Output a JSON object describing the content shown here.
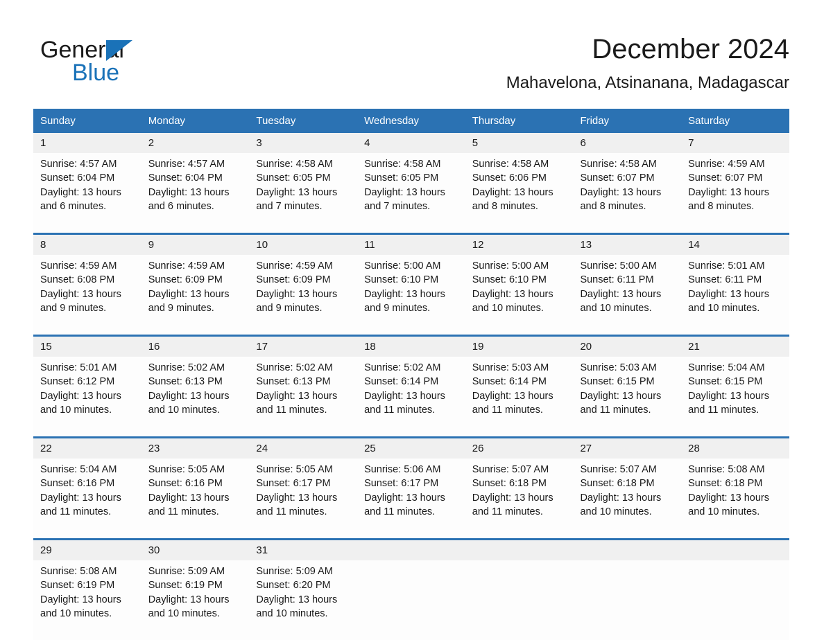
{
  "brand": {
    "word_one": "General",
    "word_two": "Blue"
  },
  "header": {
    "title": "December 2024",
    "subtitle": "Mahavelona, Atsinanana, Madagascar"
  },
  "colors": {
    "header_blue": "#2b72b3",
    "logo_blue": "#1a72b8",
    "daynum_band": "#f0f0f0",
    "cell_background": "#fdfdfd",
    "text": "#1a1a1a"
  },
  "weekday_headers": [
    "Sunday",
    "Monday",
    "Tuesday",
    "Wednesday",
    "Thursday",
    "Friday",
    "Saturday"
  ],
  "weeks": [
    {
      "days": [
        {
          "num": "1",
          "l1": "Sunrise: 4:57 AM",
          "l2": "Sunset: 6:04 PM",
          "l3": "Daylight: 13 hours",
          "l4": "and 6 minutes."
        },
        {
          "num": "2",
          "l1": "Sunrise: 4:57 AM",
          "l2": "Sunset: 6:04 PM",
          "l3": "Daylight: 13 hours",
          "l4": "and 6 minutes."
        },
        {
          "num": "3",
          "l1": "Sunrise: 4:58 AM",
          "l2": "Sunset: 6:05 PM",
          "l3": "Daylight: 13 hours",
          "l4": "and 7 minutes."
        },
        {
          "num": "4",
          "l1": "Sunrise: 4:58 AM",
          "l2": "Sunset: 6:05 PM",
          "l3": "Daylight: 13 hours",
          "l4": "and 7 minutes."
        },
        {
          "num": "5",
          "l1": "Sunrise: 4:58 AM",
          "l2": "Sunset: 6:06 PM",
          "l3": "Daylight: 13 hours",
          "l4": "and 8 minutes."
        },
        {
          "num": "6",
          "l1": "Sunrise: 4:58 AM",
          "l2": "Sunset: 6:07 PM",
          "l3": "Daylight: 13 hours",
          "l4": "and 8 minutes."
        },
        {
          "num": "7",
          "l1": "Sunrise: 4:59 AM",
          "l2": "Sunset: 6:07 PM",
          "l3": "Daylight: 13 hours",
          "l4": "and 8 minutes."
        }
      ]
    },
    {
      "days": [
        {
          "num": "8",
          "l1": "Sunrise: 4:59 AM",
          "l2": "Sunset: 6:08 PM",
          "l3": "Daylight: 13 hours",
          "l4": "and 9 minutes."
        },
        {
          "num": "9",
          "l1": "Sunrise: 4:59 AM",
          "l2": "Sunset: 6:09 PM",
          "l3": "Daylight: 13 hours",
          "l4": "and 9 minutes."
        },
        {
          "num": "10",
          "l1": "Sunrise: 4:59 AM",
          "l2": "Sunset: 6:09 PM",
          "l3": "Daylight: 13 hours",
          "l4": "and 9 minutes."
        },
        {
          "num": "11",
          "l1": "Sunrise: 5:00 AM",
          "l2": "Sunset: 6:10 PM",
          "l3": "Daylight: 13 hours",
          "l4": "and 9 minutes."
        },
        {
          "num": "12",
          "l1": "Sunrise: 5:00 AM",
          "l2": "Sunset: 6:10 PM",
          "l3": "Daylight: 13 hours",
          "l4": "and 10 minutes."
        },
        {
          "num": "13",
          "l1": "Sunrise: 5:00 AM",
          "l2": "Sunset: 6:11 PM",
          "l3": "Daylight: 13 hours",
          "l4": "and 10 minutes."
        },
        {
          "num": "14",
          "l1": "Sunrise: 5:01 AM",
          "l2": "Sunset: 6:11 PM",
          "l3": "Daylight: 13 hours",
          "l4": "and 10 minutes."
        }
      ]
    },
    {
      "days": [
        {
          "num": "15",
          "l1": "Sunrise: 5:01 AM",
          "l2": "Sunset: 6:12 PM",
          "l3": "Daylight: 13 hours",
          "l4": "and 10 minutes."
        },
        {
          "num": "16",
          "l1": "Sunrise: 5:02 AM",
          "l2": "Sunset: 6:13 PM",
          "l3": "Daylight: 13 hours",
          "l4": "and 10 minutes."
        },
        {
          "num": "17",
          "l1": "Sunrise: 5:02 AM",
          "l2": "Sunset: 6:13 PM",
          "l3": "Daylight: 13 hours",
          "l4": "and 11 minutes."
        },
        {
          "num": "18",
          "l1": "Sunrise: 5:02 AM",
          "l2": "Sunset: 6:14 PM",
          "l3": "Daylight: 13 hours",
          "l4": "and 11 minutes."
        },
        {
          "num": "19",
          "l1": "Sunrise: 5:03 AM",
          "l2": "Sunset: 6:14 PM",
          "l3": "Daylight: 13 hours",
          "l4": "and 11 minutes."
        },
        {
          "num": "20",
          "l1": "Sunrise: 5:03 AM",
          "l2": "Sunset: 6:15 PM",
          "l3": "Daylight: 13 hours",
          "l4": "and 11 minutes."
        },
        {
          "num": "21",
          "l1": "Sunrise: 5:04 AM",
          "l2": "Sunset: 6:15 PM",
          "l3": "Daylight: 13 hours",
          "l4": "and 11 minutes."
        }
      ]
    },
    {
      "days": [
        {
          "num": "22",
          "l1": "Sunrise: 5:04 AM",
          "l2": "Sunset: 6:16 PM",
          "l3": "Daylight: 13 hours",
          "l4": "and 11 minutes."
        },
        {
          "num": "23",
          "l1": "Sunrise: 5:05 AM",
          "l2": "Sunset: 6:16 PM",
          "l3": "Daylight: 13 hours",
          "l4": "and 11 minutes."
        },
        {
          "num": "24",
          "l1": "Sunrise: 5:05 AM",
          "l2": "Sunset: 6:17 PM",
          "l3": "Daylight: 13 hours",
          "l4": "and 11 minutes."
        },
        {
          "num": "25",
          "l1": "Sunrise: 5:06 AM",
          "l2": "Sunset: 6:17 PM",
          "l3": "Daylight: 13 hours",
          "l4": "and 11 minutes."
        },
        {
          "num": "26",
          "l1": "Sunrise: 5:07 AM",
          "l2": "Sunset: 6:18 PM",
          "l3": "Daylight: 13 hours",
          "l4": "and 11 minutes."
        },
        {
          "num": "27",
          "l1": "Sunrise: 5:07 AM",
          "l2": "Sunset: 6:18 PM",
          "l3": "Daylight: 13 hours",
          "l4": "and 10 minutes."
        },
        {
          "num": "28",
          "l1": "Sunrise: 5:08 AM",
          "l2": "Sunset: 6:18 PM",
          "l3": "Daylight: 13 hours",
          "l4": "and 10 minutes."
        }
      ]
    },
    {
      "days": [
        {
          "num": "29",
          "l1": "Sunrise: 5:08 AM",
          "l2": "Sunset: 6:19 PM",
          "l3": "Daylight: 13 hours",
          "l4": "and 10 minutes."
        },
        {
          "num": "30",
          "l1": "Sunrise: 5:09 AM",
          "l2": "Sunset: 6:19 PM",
          "l3": "Daylight: 13 hours",
          "l4": "and 10 minutes."
        },
        {
          "num": "31",
          "l1": "Sunrise: 5:09 AM",
          "l2": "Sunset: 6:20 PM",
          "l3": "Daylight: 13 hours",
          "l4": "and 10 minutes."
        },
        {
          "num": "",
          "l1": "",
          "l2": "",
          "l3": "",
          "l4": ""
        },
        {
          "num": "",
          "l1": "",
          "l2": "",
          "l3": "",
          "l4": ""
        },
        {
          "num": "",
          "l1": "",
          "l2": "",
          "l3": "",
          "l4": ""
        },
        {
          "num": "",
          "l1": "",
          "l2": "",
          "l3": "",
          "l4": ""
        }
      ]
    }
  ]
}
